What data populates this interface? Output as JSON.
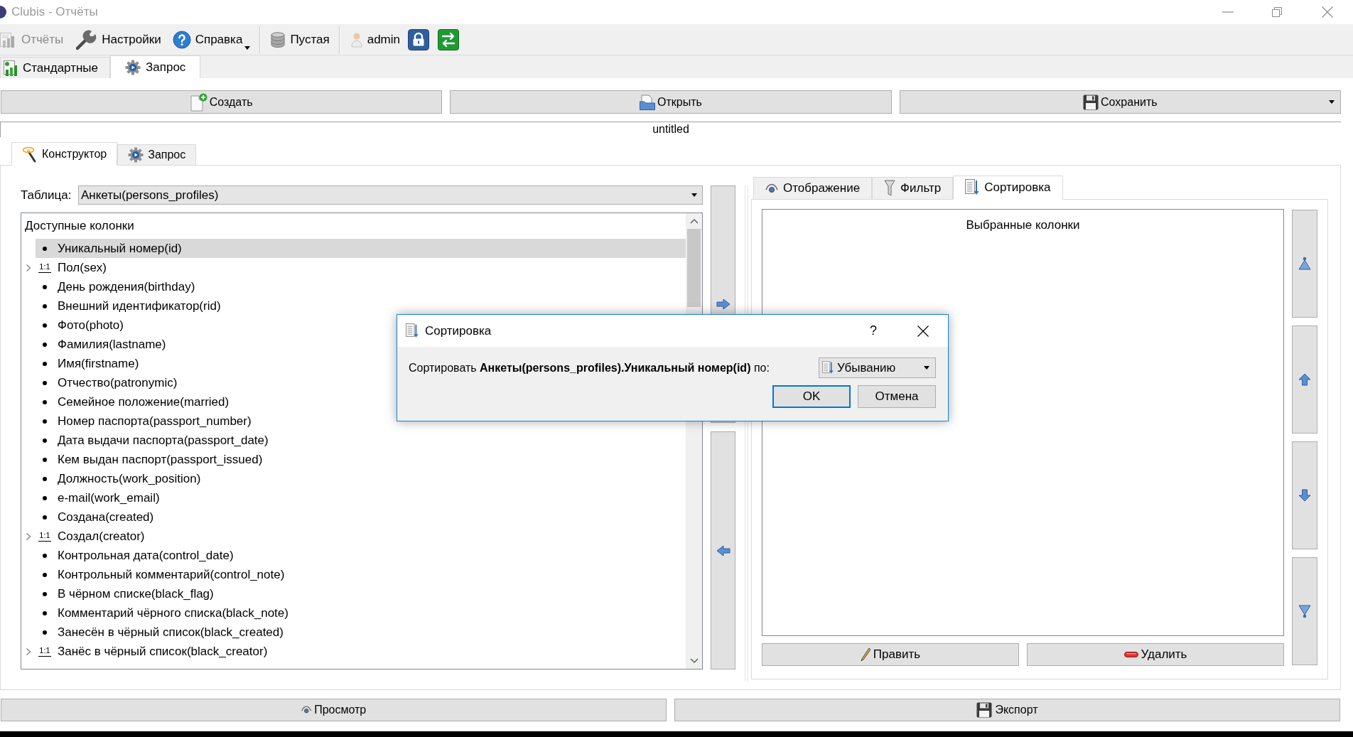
{
  "window": {
    "title": "Clubis - Отчёты"
  },
  "toolbar": {
    "items": [
      {
        "kind": "button",
        "label": "Отчёты",
        "disabled": true
      },
      {
        "kind": "button",
        "label": "Настройки",
        "disabled": false
      },
      {
        "kind": "menu",
        "label": "Справка",
        "disabled": false
      },
      {
        "kind": "separator"
      },
      {
        "kind": "button",
        "label": "Пустая",
        "disabled": false
      },
      {
        "kind": "separator"
      },
      {
        "kind": "user",
        "label": "admin"
      }
    ]
  },
  "tabs": [
    {
      "label": "Стандартные",
      "selected": false
    },
    {
      "label": "Запрос",
      "selected": true
    }
  ],
  "file_actions": [
    {
      "label": "Создать",
      "dropdown": false
    },
    {
      "label": "Открыть",
      "dropdown": false
    },
    {
      "label": "Сохранить",
      "dropdown": true
    }
  ],
  "report_name": "untitled",
  "editor_tabs": [
    {
      "label": "Конструктор",
      "selected": true
    },
    {
      "label": "Запрос",
      "selected": false
    }
  ],
  "table_field": {
    "label": "Таблица:",
    "value": "Анкеты(persons_profiles)"
  },
  "available_columns": {
    "title": "Доступные колонки",
    "items": [
      {
        "kind": "field",
        "label": "Уникальный номер(id)",
        "selected": true
      },
      {
        "kind": "relation",
        "badge": "1:1",
        "label": "Пол(sex)",
        "selected": false
      },
      {
        "kind": "field",
        "label": "День рождения(birthday)",
        "selected": false
      },
      {
        "kind": "field",
        "label": "Внешний идентификатор(rid)",
        "selected": false
      },
      {
        "kind": "field",
        "label": "Фото(photo)",
        "selected": false
      },
      {
        "kind": "field",
        "label": "Фамилия(lastname)",
        "selected": false
      },
      {
        "kind": "field",
        "label": "Имя(firstname)",
        "selected": false
      },
      {
        "kind": "field",
        "label": "Отчество(patronymic)",
        "selected": false
      },
      {
        "kind": "field",
        "label": "Семейное положение(married)",
        "selected": false
      },
      {
        "kind": "field",
        "label": "Номер паспорта(passport_number)",
        "selected": false
      },
      {
        "kind": "field",
        "label": "Дата выдачи паспорта(passport_date)",
        "selected": false
      },
      {
        "kind": "field",
        "label": "Кем выдан паспорт(passport_issued)",
        "selected": false
      },
      {
        "kind": "field",
        "label": "Должность(work_position)",
        "selected": false
      },
      {
        "kind": "field",
        "label": "e-mail(work_email)",
        "selected": false
      },
      {
        "kind": "field",
        "label": "Создана(created)",
        "selected": false
      },
      {
        "kind": "relation",
        "badge": "1:1",
        "label": "Создал(creator)",
        "selected": false
      },
      {
        "kind": "field",
        "label": "Контрольная дата(control_date)",
        "selected": false
      },
      {
        "kind": "field",
        "label": "Контрольный комментарий(control_note)",
        "selected": false
      },
      {
        "kind": "field",
        "label": "В чёрном списке(black_flag)",
        "selected": false
      },
      {
        "kind": "field",
        "label": "Комментарий чёрного списка(black_note)",
        "selected": false
      },
      {
        "kind": "field",
        "label": "Занесён в чёрный список(black_created)",
        "selected": false
      },
      {
        "kind": "relation",
        "badge": "1:1",
        "label": "Занёс в чёрный список(black_creator)",
        "selected": false
      }
    ]
  },
  "settings_tabs": [
    {
      "label": "Отображение",
      "selected": false
    },
    {
      "label": "Фильтр",
      "selected": false
    },
    {
      "label": "Сортировка",
      "selected": true
    }
  ],
  "selected_columns": {
    "title": "Выбранные колонки"
  },
  "column_actions": [
    {
      "label": "Править"
    },
    {
      "label": "Удалить"
    }
  ],
  "output_actions": [
    {
      "label": "Просмотр"
    },
    {
      "label": "Экспорт"
    }
  ],
  "dialog": {
    "title": "Сортировка",
    "help": "?",
    "message": "Сортировать **Анкеты(persons_profiles).Уникальный номер(id)** по:",
    "order": "Убыванию",
    "buttons": [
      {
        "label": "OK",
        "default": true
      },
      {
        "label": "Отмена",
        "default": false
      }
    ]
  }
}
